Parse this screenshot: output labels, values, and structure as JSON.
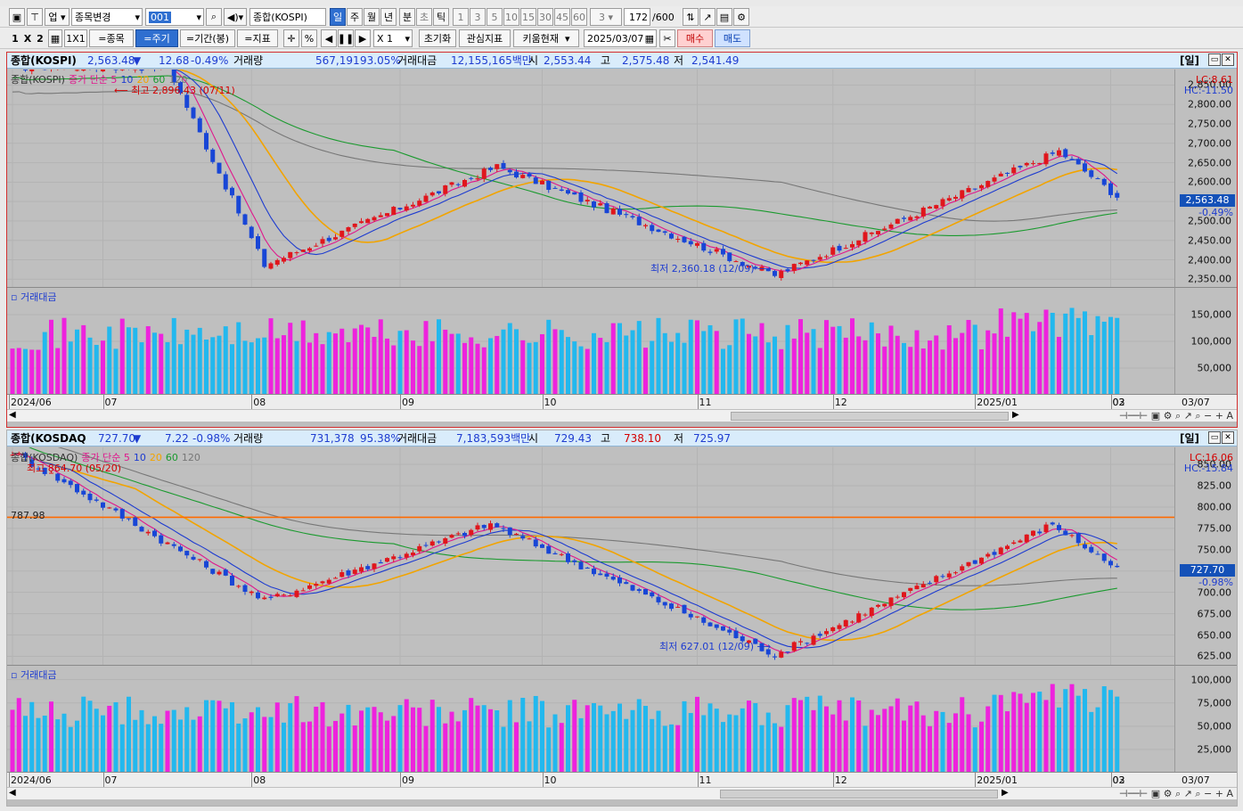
{
  "toolbar1": {
    "market": "업",
    "symbol_change": "종목변경",
    "code": "001",
    "index_name": "종합(KOSPI)",
    "periods": [
      "일",
      "주",
      "월",
      "년",
      "분",
      "초",
      "틱"
    ],
    "intervals": [
      "1",
      "3",
      "5",
      "10",
      "15",
      "30",
      "45",
      "60"
    ],
    "interval_value": "3",
    "count": "172",
    "max_count": "/600"
  },
  "toolbar2": {
    "layout_1": "1",
    "layout_x": "X",
    "layout_2": "2",
    "grid": "1X1",
    "btn_symbol": "=종목",
    "btn_period": "=주기",
    "btn_range": "=기간(봉)",
    "btn_indicator": "=지표",
    "pct": "%",
    "multiplier": "X 1",
    "btn_reset": "초기화",
    "btn_watch": "관심지표",
    "btn_kiwoom": "키움현재",
    "date": "2025/03/07",
    "btn_buy": "매수",
    "btn_sell": "매도"
  },
  "charts": [
    {
      "header": {
        "name": "종합(KOSPI)",
        "price": "2,563.48",
        "arrow": "▼",
        "change": "12.68",
        "change_pct": "-0.49%",
        "vol_label": "거래량",
        "volume": "567,191",
        "vol_ratio": "93.05%",
        "amt_label": "거래대금",
        "amount": "12,155,165백만",
        "open_label": "시",
        "open": "2,553.44",
        "high_label": "고",
        "high": "2,575.48",
        "low_label": "저",
        "low": "2,541.49",
        "day_tag": "[일]"
      },
      "legend": {
        "title": "종합(KOSPI)",
        "ma": "종가 단순 5",
        "p10": "10",
        "p20": "20",
        "p60": "60",
        "p120": "120"
      },
      "lc": "LC:8.61",
      "hc": "HC:-11.50",
      "current_tag": "2,563.48",
      "current_pct": "-0.49%",
      "max_note": "최고 2,896.43 (07/11)",
      "min_note": "최저 2,360.18 (12/09)",
      "vol_title": "거래대금",
      "price_ticks": [
        "2,850.00",
        "2,800.00",
        "2,750.00",
        "2,700.00",
        "2,650.00",
        "2,600.00",
        "2,550.00",
        "2,500.00",
        "2,450.00",
        "2,400.00",
        "2,350.00"
      ],
      "vol_ticks": [
        "150,000",
        "100,000",
        "50,000"
      ],
      "x_labels": [
        "2024/06",
        "07",
        "08",
        "09",
        "10",
        "11",
        "12",
        "2025/01",
        "02",
        "03"
      ],
      "x_end": "03/07"
    },
    {
      "header": {
        "name": "종합(KOSDAQ",
        "price": "727.70",
        "arrow": "▼",
        "change": "7.22",
        "change_pct": "-0.98%",
        "vol_label": "거래량",
        "volume": "731,378",
        "vol_ratio": "95.38%",
        "amt_label": "거래대금",
        "amount": "7,183,593백만",
        "open_label": "시",
        "open": "729.43",
        "high_label": "고",
        "high": "738.10",
        "low_label": "저",
        "low": "725.97",
        "day_tag": "[일]"
      },
      "legend": {
        "title": "종합(KOSDAQ)",
        "ma": "종가 단순 5",
        "p10": "10",
        "p20": "20",
        "p60": "60",
        "p120": "120"
      },
      "lc": "LC:16.06",
      "hc": "HC:-15.84",
      "current_tag": "727.70",
      "current_pct": "-0.98%",
      "max_note": "최고 864.70 (05/20)",
      "min_note": "최저 627.01 (12/09)",
      "hline_label": "787.98",
      "vol_title": "거래대금",
      "price_ticks": [
        "850.00",
        "825.00",
        "800.00",
        "775.00",
        "750.00",
        "725.00",
        "700.00",
        "675.00",
        "650.00",
        "625.00"
      ],
      "vol_ticks": [
        "100,000",
        "75,000",
        "50,000",
        "25,000"
      ],
      "x_labels": [
        "2024/06",
        "07",
        "08",
        "09",
        "10",
        "11",
        "12",
        "2025/01",
        "02",
        "03"
      ],
      "x_end": "03/07"
    }
  ],
  "chart_data": [
    {
      "type": "candlestick",
      "title": "종합(KOSPI)",
      "ylim": [
        2330,
        2890
      ],
      "x_range": [
        "2024/06",
        "2025/03/07"
      ],
      "key_points": [
        {
          "date": "2024/07/11",
          "value": 2896.43,
          "label": "최고"
        },
        {
          "date": "2024/08/05",
          "value": 2386
        },
        {
          "date": "2024/10/01",
          "value": 2640
        },
        {
          "date": "2024/12/09",
          "value": 2360.18,
          "label": "최저"
        },
        {
          "date": "2025/02/18",
          "value": 2680
        },
        {
          "date": "2025/03/07",
          "value": 2563.48
        }
      ],
      "volume_ylim": [
        0,
        200000
      ],
      "colors": {
        "up": "#e0161c",
        "down": "#1846d6",
        "ma5": "#e0168c",
        "ma10": "#1e3cd0",
        "ma20": "#f2a400",
        "ma60": "#1b9a2f",
        "ma120": "#777777",
        "vol_up": "#ee22dd",
        "vol_down": "#22b8ee"
      }
    },
    {
      "type": "candlestick",
      "title": "종합(KOSDAQ)",
      "ylim": [
        615,
        870
      ],
      "x_range": [
        "2024/06",
        "2025/03/07"
      ],
      "key_points": [
        {
          "date": "2024/05/20",
          "value": 864.7,
          "label": "최고"
        },
        {
          "date": "2024/08/05",
          "value": 690
        },
        {
          "date": "2024/09/30",
          "value": 780
        },
        {
          "date": "2024/12/09",
          "value": 627.01,
          "label": "최저"
        },
        {
          "date": "2025/02/17",
          "value": 780
        },
        {
          "date": "2025/03/07",
          "value": 727.7
        }
      ],
      "hline": 787.98,
      "volume_ylim": [
        0,
        115000
      ],
      "colors": {
        "up": "#e0161c",
        "down": "#1846d6",
        "ma5": "#e0168c",
        "ma10": "#1e3cd0",
        "ma20": "#f2a400",
        "ma60": "#1b9a2f",
        "ma120": "#777777",
        "hline": "#ff6a00",
        "vol_up": "#ee22dd",
        "vol_down": "#22b8ee"
      }
    }
  ]
}
